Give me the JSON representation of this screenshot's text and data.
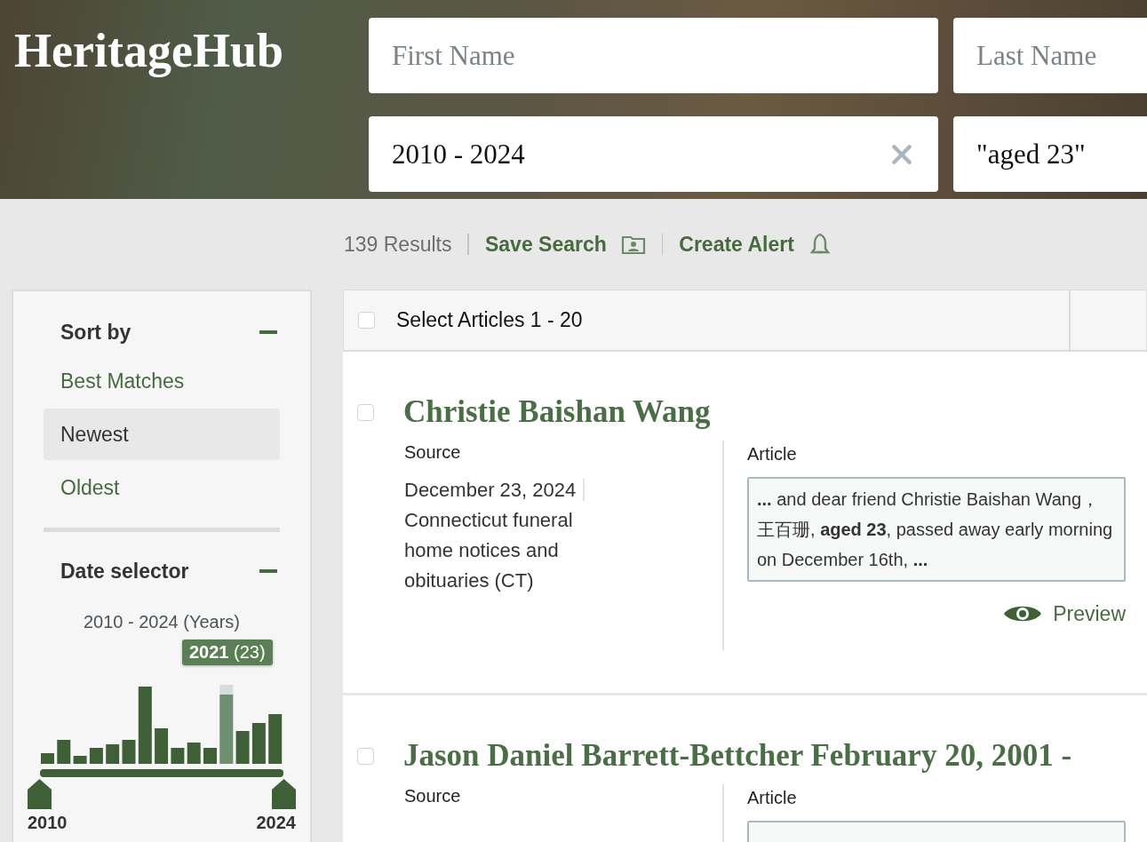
{
  "logo": "HeritageHub",
  "search": {
    "fields": [
      {
        "placeholder": "First Name",
        "clearable": false
      },
      {
        "placeholder": "Last Name"
      },
      {
        "value": "2010 - 2024",
        "clearable": true
      },
      {
        "value": "\"aged 23\""
      }
    ]
  },
  "results_bar": {
    "count": "139 Results",
    "actions": [
      {
        "label": "Save Search",
        "kind": "folder"
      },
      {
        "label": "Create Alert",
        "kind": "bell"
      }
    ]
  },
  "sidebar": {
    "sort": {
      "title": "Sort by",
      "expanded": true,
      "options": [
        {
          "label": "Best Matches",
          "selected": false
        },
        {
          "label": "Newest",
          "selected": true
        },
        {
          "label": "Oldest",
          "selected": false
        }
      ]
    },
    "date_selector": {
      "title": "Date selector",
      "expanded": true,
      "range_label": "2010 - 2024 (Years)",
      "tooltip": {
        "year": "2021",
        "count": "(23)"
      },
      "start_label": "2010",
      "end_label": "2024"
    }
  },
  "list": {
    "select_all": {
      "label": "Select Articles 1 - 20",
      "checked": false
    },
    "articles": [
      {
        "title": "Christie Baishan Wang",
        "checked": false,
        "source_label": "Source",
        "date": "December 23, 2024",
        "source": "Connecticut funeral home notices and obituaries (CT)",
        "article_label": "Article",
        "snippet": "**...** and dear friend Christie Baishan Wang，王百珊, **aged 23**, passed away early morning on December 16th, **...**",
        "preview": "Preview"
      },
      {
        "title": "Jason Daniel Barrett-Bettcher February 20, 2001 -",
        "checked": false,
        "source_label": "Source",
        "article_label": "Article"
      }
    ]
  }
}
